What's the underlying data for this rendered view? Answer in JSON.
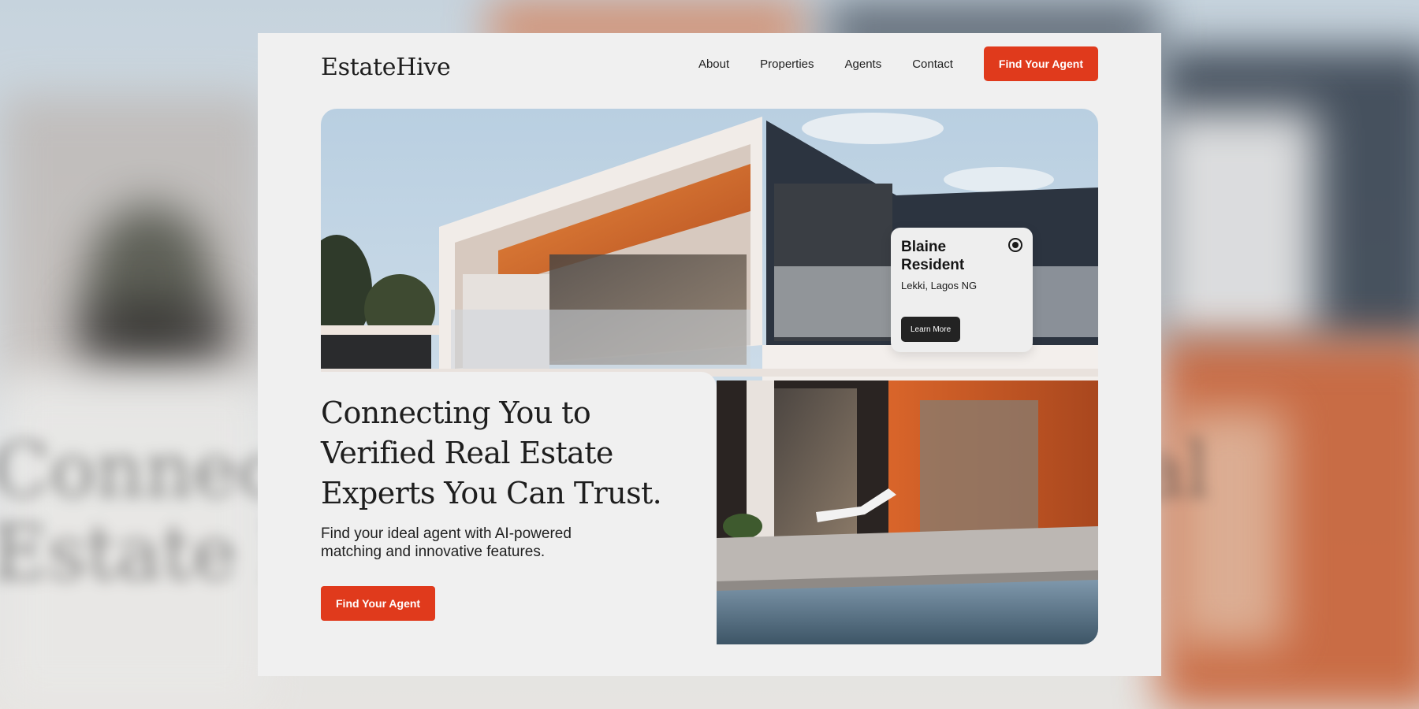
{
  "brand": {
    "logo_text": "EstateHive"
  },
  "nav": {
    "links": [
      {
        "label": "About"
      },
      {
        "label": "Properties"
      },
      {
        "label": "Agents"
      },
      {
        "label": "Contact"
      }
    ],
    "cta_label": "Find Your Agent"
  },
  "hero": {
    "headline": "Connecting You to Verified Real Estate Experts You Can Trust.",
    "subtext": "Find your ideal agent with AI-powered matching and innovative features.",
    "cta_label": "Find Your Agent"
  },
  "agent_card": {
    "name": "Blaine Resident",
    "location": "Lekki, Lagos NG",
    "button_label": "Learn More"
  },
  "colors": {
    "accent": "#e03a1c",
    "page_bg": "#f0f0f0",
    "text": "#1e1e1e",
    "card_button": "#232323"
  }
}
